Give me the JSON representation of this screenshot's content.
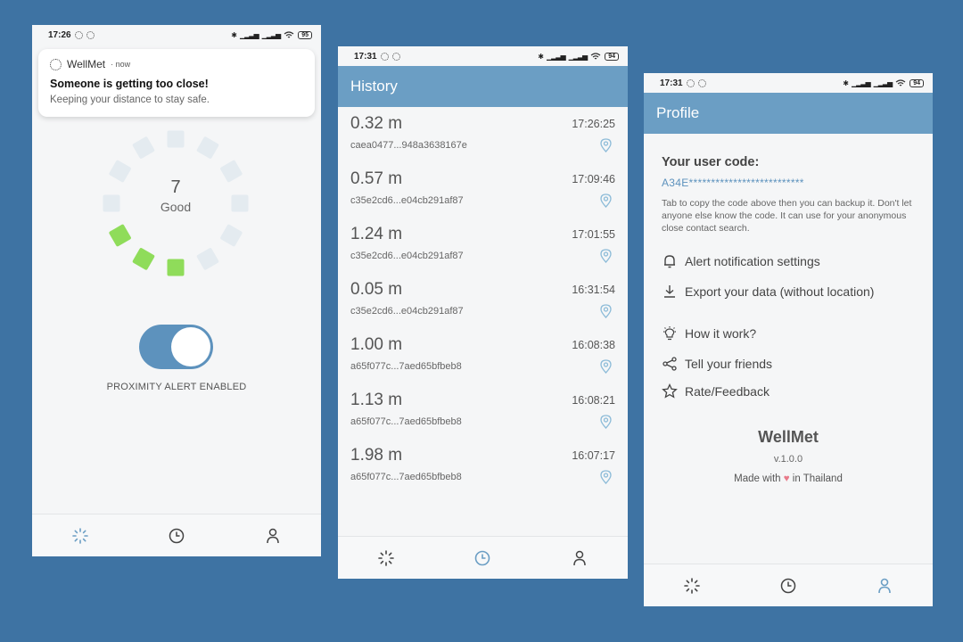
{
  "screens": {
    "live": {
      "status_time": "17:26",
      "battery": "95",
      "notification": {
        "app": "WellMet",
        "time": "now",
        "title": "Someone is getting too close!",
        "text": "Keeping your distance to stay safe."
      },
      "gauge": {
        "value": "7",
        "label": "Good",
        "segments_total": 12,
        "segments_active": 3,
        "active_color": "#8fdc5a",
        "inactive_color": "#e4ebf0"
      },
      "toggle": {
        "on": true,
        "label": "PROXIMITY ALERT ENABLED"
      }
    },
    "history": {
      "status_time": "17:31",
      "battery": "94",
      "title": "History",
      "items": [
        {
          "distance": "0.32 m",
          "id": "caea0477...948a3638167e",
          "time": "17:26:25"
        },
        {
          "distance": "0.57 m",
          "id": "c35e2cd6...e04cb291af87",
          "time": "17:09:46"
        },
        {
          "distance": "1.24 m",
          "id": "c35e2cd6...e04cb291af87",
          "time": "17:01:55"
        },
        {
          "distance": "0.05 m",
          "id": "c35e2cd6...e04cb291af87",
          "time": "16:31:54"
        },
        {
          "distance": "1.00 m",
          "id": "a65f077c...7aed65bfbeb8",
          "time": "16:08:38"
        },
        {
          "distance": "1.13 m",
          "id": "a65f077c...7aed65bfbeb8",
          "time": "16:08:21"
        },
        {
          "distance": "1.98 m",
          "id": "a65f077c...7aed65bfbeb8",
          "time": "16:07:17"
        }
      ]
    },
    "profile": {
      "status_time": "17:31",
      "battery": "94",
      "title": "Profile",
      "user_code_label": "Your user code:",
      "user_code": "A34E**************************",
      "help_text": "Tab to copy the code above then you can backup it. Don't let anyone else know the code. It can use for your anonymous close contact search.",
      "menu": [
        {
          "label": "Alert notification settings",
          "icon": "bell-icon"
        },
        {
          "label": "Export your data (without location)",
          "icon": "download-icon"
        },
        {
          "label": "How it work?",
          "icon": "lightbulb-icon"
        },
        {
          "label": "Tell your friends",
          "icon": "share-icon"
        },
        {
          "label": "Rate/Feedback",
          "icon": "star-icon"
        }
      ],
      "app_name": "WellMet",
      "version": "v.1.0.0",
      "made_prefix": "Made with",
      "made_suffix": "in Thailand"
    }
  },
  "nav": {
    "tabs": [
      "radar-icon",
      "history-icon",
      "profile-icon"
    ],
    "active_color": "#6b9ec4",
    "inactive_color": "#555555"
  },
  "colors": {
    "background": "#3e73a3",
    "appbar": "#6b9ec4",
    "accent": "#5d92bd"
  }
}
